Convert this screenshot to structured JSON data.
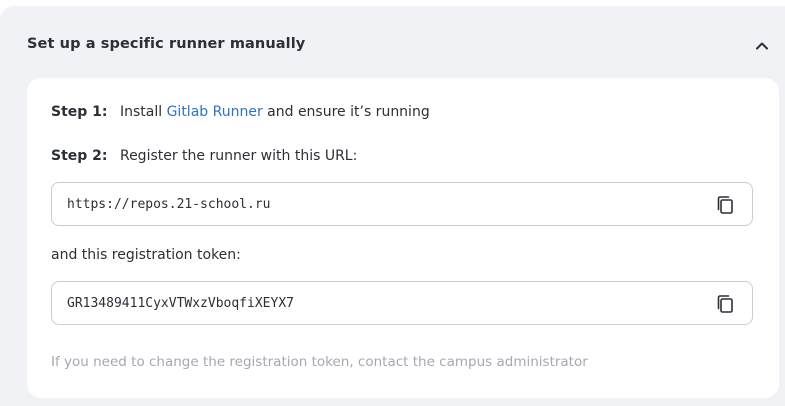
{
  "section": {
    "title": "Set up a specific runner manually",
    "collapse_icon": "chevron-up-icon"
  },
  "steps": {
    "step1": {
      "label": "Step 1:",
      "text_before": "Install",
      "link_text": "Gitlab Runner",
      "text_after": "and ensure it’s running"
    },
    "step2": {
      "label": "Step 2:",
      "text": "Register the runner with this URL:"
    }
  },
  "url_field": {
    "value": "https://repos.21-school.ru",
    "copy_icon": "copy-icon"
  },
  "token_caption": "and this registration token:",
  "token_field": {
    "value": "GR13489411CyxVTWxzVboqfiXEYX7",
    "copy_icon": "copy-icon"
  },
  "hint": "If you need to change the registration token, contact the campus administrator",
  "colors": {
    "panel_background": "#f1f2f6",
    "card_background": "#ffffff",
    "link": "#2f72c4",
    "hint_text": "#a3a8b2",
    "field_border": "#c9ccd3"
  }
}
